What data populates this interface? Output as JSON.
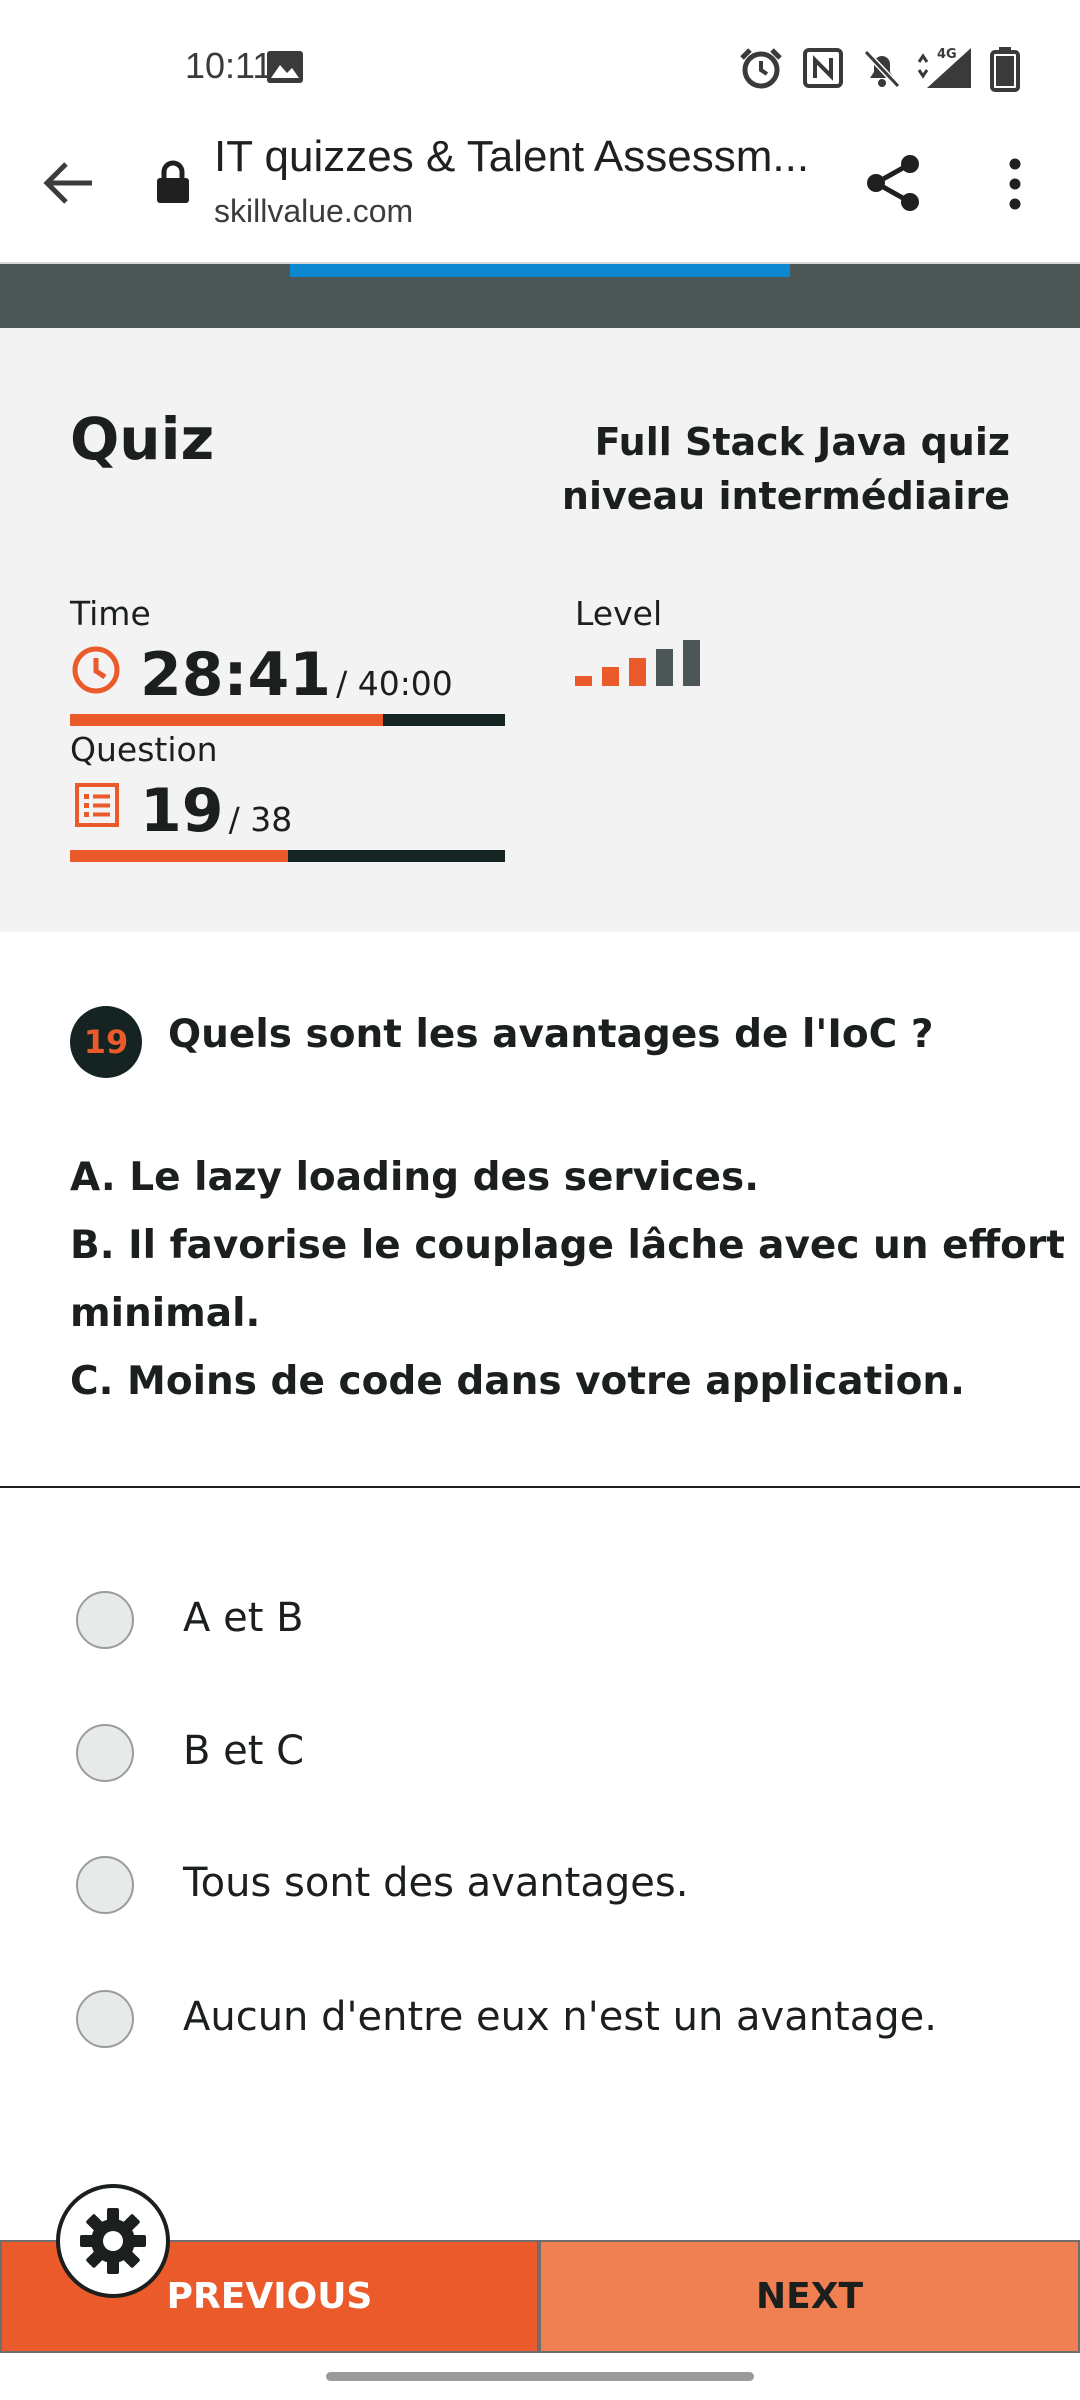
{
  "status_bar": {
    "time": "10:11",
    "icons": [
      "image-icon",
      "alarm-icon",
      "nfc-icon",
      "bell-off-icon",
      "signal-4g-icon",
      "battery-icon"
    ],
    "network": "4G"
  },
  "browser": {
    "title": "IT quizzes & Talent Assessm...",
    "domain": "skillvalue.com",
    "icons": [
      "back-arrow-icon",
      "lock-icon",
      "share-icon",
      "more-vert-icon"
    ]
  },
  "quiz": {
    "heading": "Quiz",
    "name": "Full Stack Java quiz niveau intermédiaire",
    "time_label": "Time",
    "time_remaining": "28:41",
    "time_total": "/ 40:00",
    "time_progress": 0.72,
    "level_label": "Level",
    "level_value": 3,
    "level_max": 5,
    "question_label": "Question",
    "question_current": "19",
    "question_total": "/ 38",
    "question_progress": 0.5
  },
  "question": {
    "number": "19",
    "text": "Quels sont les avantages de l'IoC ?",
    "statements": [
      "A. Le lazy loading des services.",
      "B. Il favorise le couplage lâche avec un effort",
      "minimal.",
      "C. Moins de code dans votre application."
    ]
  },
  "answers": [
    {
      "label": "A et B",
      "selected": false
    },
    {
      "label": "B et C",
      "selected": false
    },
    {
      "label": "Tous sont des avantages.",
      "selected": false
    },
    {
      "label": "Aucun d'entre eux n'est un avantage.",
      "selected": false
    }
  ],
  "nav": {
    "previous_label": "PREVIOUS",
    "next_label": "NEXT"
  },
  "colors": {
    "accent": "#ea5a2a",
    "dark": "#152323",
    "header": "#4d5657",
    "progress_blue": "#0b88cf",
    "panel_bg": "#f3f3f3"
  }
}
